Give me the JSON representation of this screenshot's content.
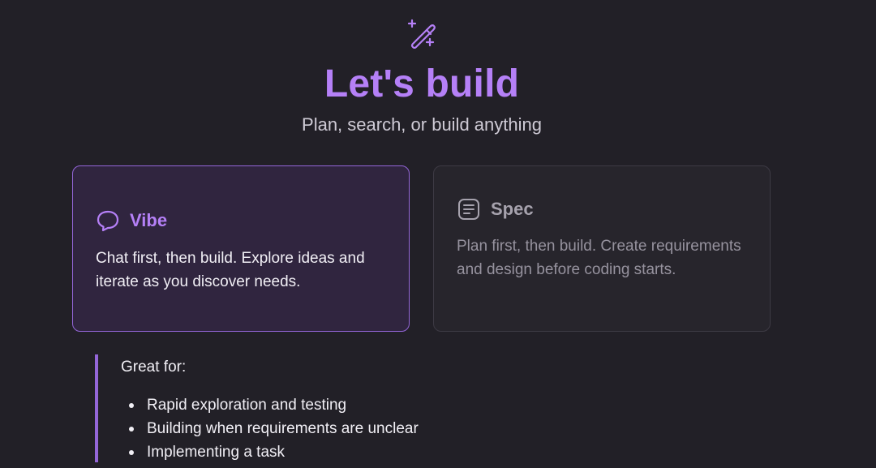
{
  "header": {
    "icon": "magic-wand-icon",
    "title": "Let's build",
    "subtitle": "Plan, search, or build anything"
  },
  "modes": [
    {
      "id": "vibe",
      "icon": "chat-bubble-icon",
      "title": "Vibe",
      "description": "Chat first, then build. Explore ideas and iterate as you discover needs.",
      "selected": true
    },
    {
      "id": "spec",
      "icon": "document-lines-icon",
      "title": "Spec",
      "description": "Plan first, then build. Create requirements and design before coding starts.",
      "selected": false
    }
  ],
  "great_for": {
    "title": "Great for:",
    "items": [
      "Rapid exploration and testing",
      "Building when requirements are unclear",
      "Implementing a task"
    ]
  },
  "colors": {
    "background": "#222027",
    "accent": "#b580f7",
    "selected_card_bg": "#30253f",
    "selected_card_border": "#9466d8",
    "card_bg": "#27252c"
  }
}
